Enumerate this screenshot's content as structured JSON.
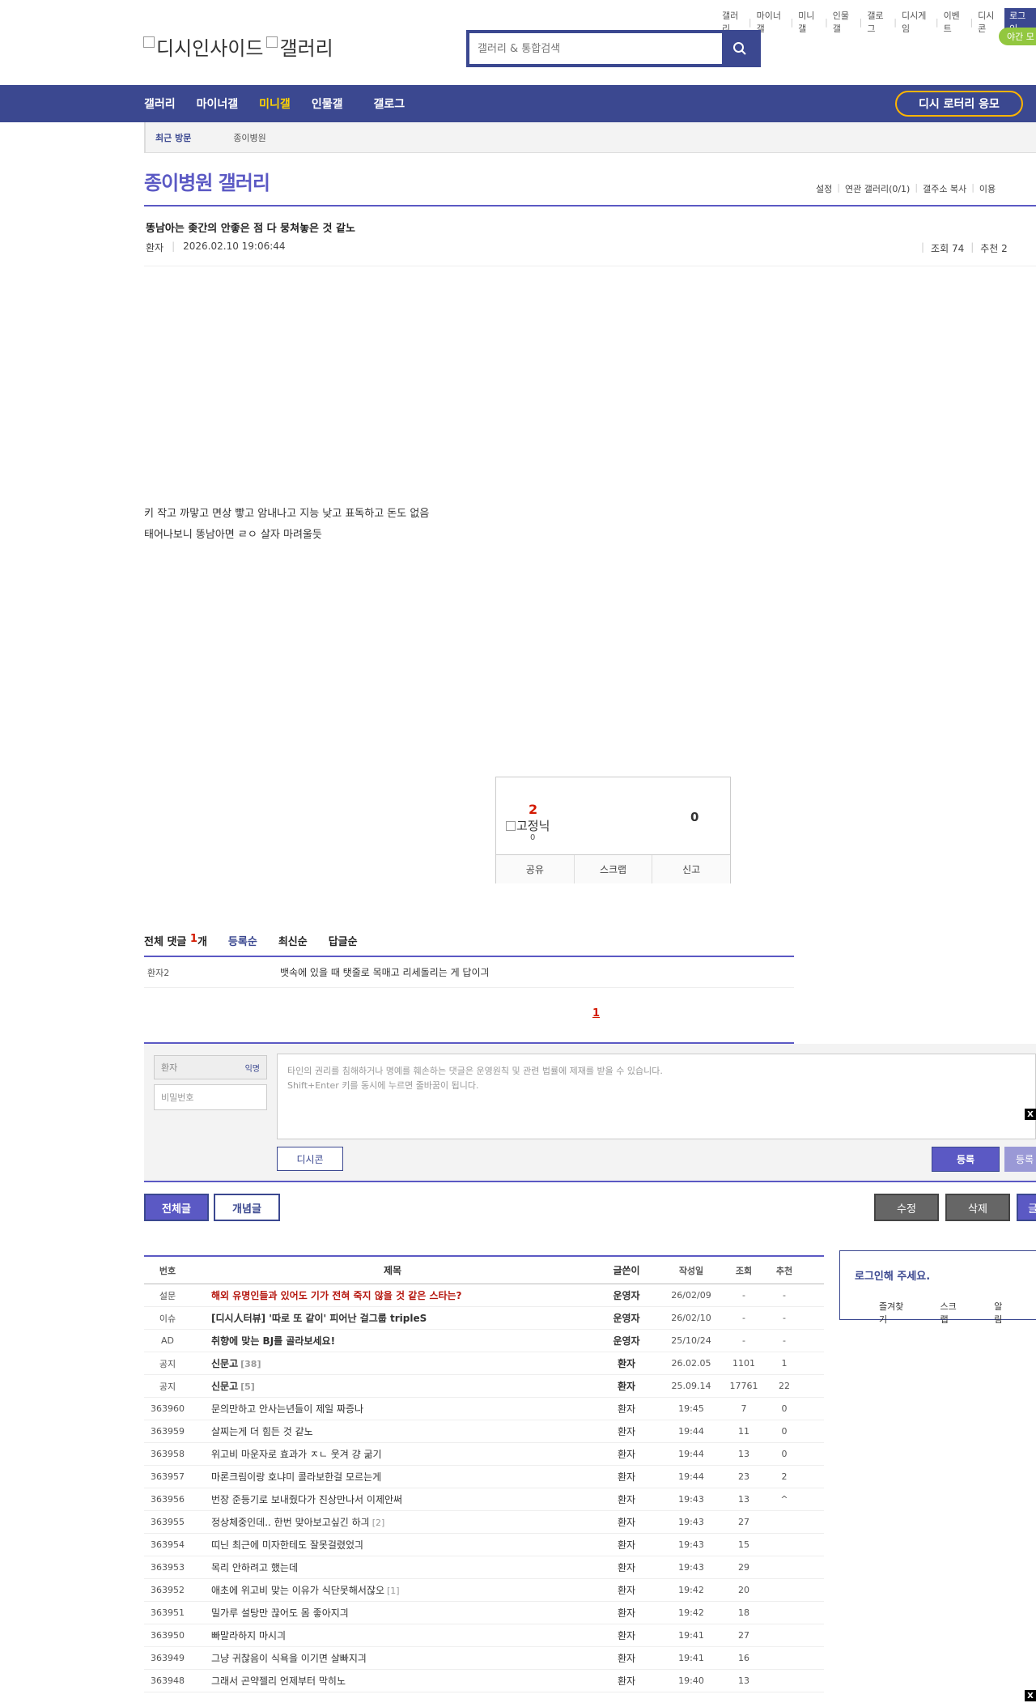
{
  "util_links": [
    "갤러리",
    "마이너갤",
    "미니갤",
    "인물갤",
    "갤로그",
    "디시게임",
    "이벤트",
    "디시콘"
  ],
  "util_login": "로그인",
  "night_mode": "야간 모",
  "logo_text": "디시인사이드",
  "logo_text2": "갤러리",
  "search": {
    "placeholder": "갤러리 & 통합검색"
  },
  "gnb": {
    "items": [
      "갤러리",
      "마이너갤",
      "미니갤",
      "인물갤",
      "갤로그"
    ],
    "active_index": 2,
    "lottery": "디시 로터리 응모"
  },
  "recent": {
    "label": "최근 방문",
    "value": "종이병원"
  },
  "gallery": {
    "title": "종이병원 갤러리",
    "tools": [
      "설정",
      "연관 갤러리(0/1)",
      "갤주소 복사",
      "이용"
    ]
  },
  "post": {
    "title": "똥남아는 좆간의 안좋은 점 다 뭉쳐놓은 것 같노",
    "writer": "환자",
    "datetime": "2026.02.10 19:06:44",
    "views": "조회 74",
    "recommends": "추천 2",
    "body": [
      "키 작고 까맣고 면상 빻고 암내나고 지능 낮고 표독하고 돈도 없음",
      "태어나보니 똥남아면 ㄹㅇ 살자 마려울듯"
    ]
  },
  "recommend_box": {
    "up": "2",
    "fix_label": "고정닉",
    "fix_count": "0",
    "down": "0",
    "actions": [
      "공유",
      "스크랩",
      "신고"
    ]
  },
  "comments": {
    "header_label": "전체 댓글",
    "count": "1",
    "count_suffix": "개",
    "sorts": [
      "등록순",
      "최신순",
      "답글순"
    ],
    "items": [
      {
        "nick": "환자2",
        "text": "뱃속에 있을 때 탯줄로 목매고 리세돌리는 게 답이긔"
      }
    ],
    "page": "1"
  },
  "write": {
    "nick": "환자",
    "anon_label": "익명",
    "password_placeholder": "비밀번호",
    "textarea_lines": [
      "타인의 권리를 침해하거나 명예를 훼손하는 댓글은 운영원칙 및 관련 법률에 제재를 받을 수 있습니다.",
      "Shift+Enter 키를 동시에 누르면 줄바꿈이 됩니다."
    ],
    "dccon": "디시콘",
    "submit": "등록",
    "submit2": "등록",
    "close": "X"
  },
  "list_buttons": {
    "all": "전체글",
    "concept": "개념글",
    "edit": "수정",
    "delete": "삭제",
    "write": "글"
  },
  "table": {
    "headers": [
      "번호",
      "제목",
      "글쓴이",
      "작성일",
      "조회",
      "추천"
    ],
    "rows": [
      {
        "num": "설문",
        "title": "해외 유명인들과 있어도 기가 전혀 죽지 않을 것 같은 스타는?",
        "reply": "",
        "writer": "운영자",
        "date": "26/02/09",
        "views": "-",
        "rec": "-",
        "notice": true,
        "red": true
      },
      {
        "num": "이슈",
        "title": "[디시人터뷰] '따로 또 같이' 피어난 걸그룹 tripleS",
        "reply": "",
        "writer": "운영자",
        "date": "26/02/10",
        "views": "-",
        "rec": "-",
        "notice": true,
        "red": false
      },
      {
        "num": "AD",
        "title": "취향에 맞는 BJ를 골라보세요!",
        "reply": "",
        "writer": "운영자",
        "date": "25/10/24",
        "views": "-",
        "rec": "-",
        "notice": true,
        "red": false
      },
      {
        "num": "공지",
        "title": "신문고",
        "reply": "[38]",
        "writer": "환자",
        "date": "26.02.05",
        "views": "1101",
        "rec": "1",
        "notice": true,
        "red": false
      },
      {
        "num": "공지",
        "title": "신문고",
        "reply": "[5]",
        "writer": "환자",
        "date": "25.09.14",
        "views": "17761",
        "rec": "22",
        "notice": true,
        "red": false
      },
      {
        "num": "363960",
        "title": "문의만하고 안사는년들이 제일 짜증나",
        "reply": "",
        "writer": "환자",
        "date": "19:45",
        "views": "7",
        "rec": "0",
        "notice": false,
        "red": false
      },
      {
        "num": "363959",
        "title": "살찌는게 더 힘든 것 같노",
        "reply": "",
        "writer": "환자",
        "date": "19:44",
        "views": "11",
        "rec": "0",
        "notice": false,
        "red": false
      },
      {
        "num": "363958",
        "title": "위고비 마운자로 효과가 ㅈㄴ 웃겨 걍 굶기",
        "reply": "",
        "writer": "환자",
        "date": "19:44",
        "views": "13",
        "rec": "0",
        "notice": false,
        "red": false
      },
      {
        "num": "363957",
        "title": "마론크림이랑 호냐미 콜라보한걸 모르는게",
        "reply": "",
        "writer": "환자",
        "date": "19:44",
        "views": "23",
        "rec": "2",
        "notice": false,
        "red": false
      },
      {
        "num": "363956",
        "title": "번장 준등기로 보내줬다가 진상만나서 이제안써",
        "reply": "",
        "writer": "환자",
        "date": "19:43",
        "views": "13",
        "rec": "^",
        "notice": false,
        "red": false
      },
      {
        "num": "363955",
        "title": "정상체중인데.. 한번 맞아보고싶긴 하긔",
        "reply": "[2]",
        "writer": "환자",
        "date": "19:43",
        "views": "27",
        "rec": "",
        "notice": false,
        "red": false
      },
      {
        "num": "363954",
        "title": "띠닌 최근에 미자한테도 잘못걸렸었긔",
        "reply": "",
        "writer": "환자",
        "date": "19:43",
        "views": "15",
        "rec": "",
        "notice": false,
        "red": false
      },
      {
        "num": "363953",
        "title": "목리 안하려고 했는데",
        "reply": "",
        "writer": "환자",
        "date": "19:43",
        "views": "29",
        "rec": "",
        "notice": false,
        "red": false
      },
      {
        "num": "363952",
        "title": "애초에 위고비 맞는 이유가 식단못해서잖오",
        "reply": "[1]",
        "writer": "환자",
        "date": "19:42",
        "views": "20",
        "rec": "",
        "notice": false,
        "red": false
      },
      {
        "num": "363951",
        "title": "밀가루 설탕만 끊어도 몸 좋아지긔",
        "reply": "",
        "writer": "환자",
        "date": "19:42",
        "views": "18",
        "rec": "",
        "notice": false,
        "red": false
      },
      {
        "num": "363950",
        "title": "빠말라하지 마시긔",
        "reply": "",
        "writer": "환자",
        "date": "19:41",
        "views": "27",
        "rec": "",
        "notice": false,
        "red": false
      },
      {
        "num": "363949",
        "title": "그냥 귀찮음이 식욕을 이기면 살빠지긔",
        "reply": "",
        "writer": "환자",
        "date": "19:41",
        "views": "16",
        "rec": "",
        "notice": false,
        "red": false
      },
      {
        "num": "363948",
        "title": "그래서 곤약젤리 언제부터 막히노",
        "reply": "",
        "writer": "환자",
        "date": "19:40",
        "views": "13",
        "rec": "",
        "notice": false,
        "red": false
      }
    ]
  },
  "sidebox": {
    "title": "로그인해 주세요.",
    "links": [
      "즐겨찾기",
      "스크랩",
      "알림"
    ]
  },
  "corner_close": "X"
}
